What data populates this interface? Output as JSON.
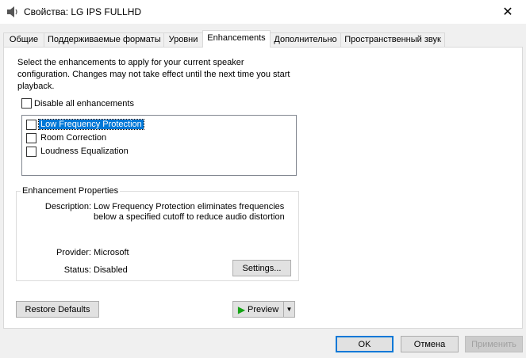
{
  "window": {
    "title": "Свойства: LG IPS FULLHD",
    "close_glyph": "✕"
  },
  "tabs": [
    {
      "label": "Общие"
    },
    {
      "label": "Поддерживаемые форматы"
    },
    {
      "label": "Уровни"
    },
    {
      "label": "Enhancements"
    },
    {
      "label": "Дополнительно"
    },
    {
      "label": "Пространственный звук"
    }
  ],
  "active_tab": "Enhancements",
  "enhancements": {
    "description_lines": [
      "Select the enhancements to apply for your current speaker",
      "configuration. Changes may not take effect until the next time you start",
      "playback."
    ],
    "disable_all_label": "Disable all enhancements",
    "disable_all_checked": false,
    "items": [
      {
        "label": "Low Frequency Protection",
        "checked": false,
        "selected": true
      },
      {
        "label": "Room Correction",
        "checked": false,
        "selected": false
      },
      {
        "label": "Loudness Equalization",
        "checked": false,
        "selected": false
      }
    ]
  },
  "properties": {
    "group_title": "Enhancement Properties",
    "description_label": "Description:",
    "description_lines": [
      "Low Frequency Protection eliminates frequencies",
      "below a specified cutoff to reduce audio distortion"
    ],
    "provider_label": "Provider:",
    "provider_value": "Microsoft",
    "status_label": "Status:",
    "status_value": "Disabled",
    "settings_button": "Settings..."
  },
  "buttons": {
    "restore_defaults": "Restore Defaults",
    "preview": "Preview",
    "ok": "OK",
    "cancel": "Отмена",
    "apply": "Применить"
  },
  "colors": {
    "selection": "#0078d7",
    "play_icon": "#15a315"
  }
}
